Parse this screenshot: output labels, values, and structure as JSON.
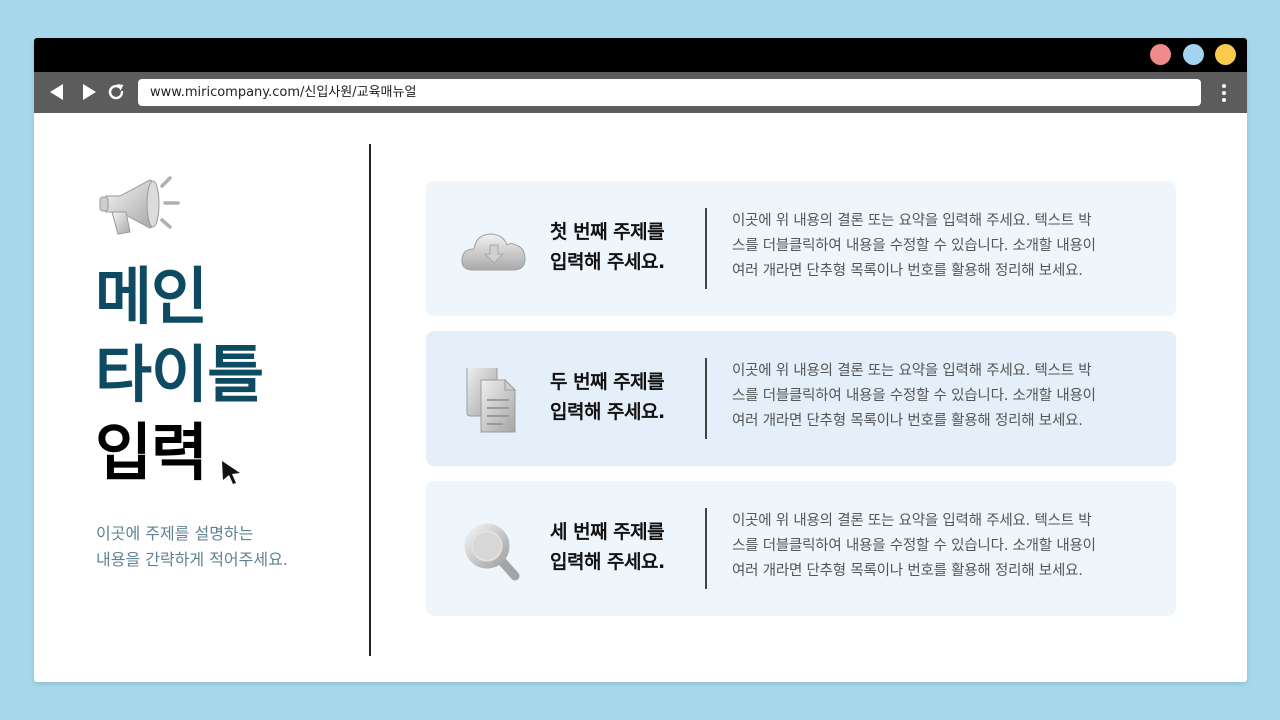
{
  "browser": {
    "url": "www.miricompany.com/신입사원/교육매뉴얼",
    "window_colors": [
      "#ef8a8a",
      "#a3d3ef",
      "#f8cb4d"
    ]
  },
  "hero": {
    "title_lines": [
      "메인",
      "타이틀",
      "입력"
    ],
    "title_colors": [
      "#0f4a63",
      "#0f4a63",
      "#000000"
    ],
    "subtitle_lines": [
      "이곳에 주제를 설명하는",
      "내용을 간략하게 적어주세요."
    ]
  },
  "cards": [
    {
      "icon": "cloud-download-icon",
      "title_lines": [
        "첫 번째 주제를",
        "입력해 주세요."
      ],
      "body_lines": [
        "이곳에 위 내용의 결론 또는 요약을 입력해 주세요. 텍스트 박",
        "스를 더블클릭하여 내용을 수정할 수 있습니다. 소개할 내용이",
        "여러 개라면 단추형 목록이나 번호를 활용해 정리해 보세요."
      ],
      "bg": "#eef6fc"
    },
    {
      "icon": "documents-icon",
      "title_lines": [
        "두 번째 주제를",
        "입력해 주세요."
      ],
      "body_lines": [
        "이곳에 위 내용의 결론 또는 요약을 입력해 주세요. 텍스트 박",
        "스를 더블클릭하여 내용을 수정할 수 있습니다. 소개할 내용이",
        "여러 개라면 단추형 목록이나 번호를 활용해 정리해 보세요."
      ],
      "bg": "#e4eff9"
    },
    {
      "icon": "magnifier-icon",
      "title_lines": [
        "세 번째 주제를",
        "입력해 주세요."
      ],
      "body_lines": [
        "이곳에 위 내용의 결론 또는 요약을 입력해 주세요. 텍스트 박",
        "스를 더블클릭하여 내용을 수정할 수 있습니다. 소개할 내용이",
        "여러 개라면 단추형 목록이나 번호를 활용해 정리해 보세요."
      ],
      "bg": "#eef6fc"
    }
  ]
}
